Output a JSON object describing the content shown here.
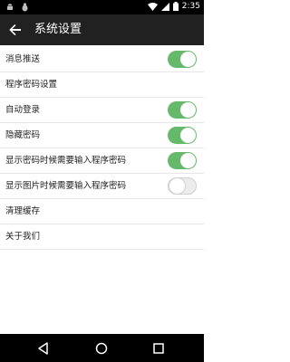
{
  "status_bar": {
    "time": "2:35",
    "icons": [
      "android-icon",
      "bug-icon",
      "wifi-icon",
      "signal-icon",
      "battery-icon"
    ]
  },
  "app_bar": {
    "title": "系统设置",
    "back_icon": "arrow-back-icon"
  },
  "settings": [
    {
      "label": "消息推送",
      "toggle": true
    },
    {
      "label": "程序密码设置"
    },
    {
      "label": "自动登录",
      "toggle": true
    },
    {
      "label": "隐藏密码",
      "toggle": true
    },
    {
      "label": "显示密码时候需要输入程序密码",
      "toggle": true
    },
    {
      "label": "显示图片时候需要输入程序密码",
      "toggle": false
    },
    {
      "label": "清理缓存"
    },
    {
      "label": "关于我们"
    }
  ],
  "nav_bar": {
    "buttons": [
      "back-icon",
      "home-icon",
      "recents-icon"
    ]
  },
  "colors": {
    "status_bar": "#000000",
    "app_bar": "#212121",
    "switch_on": "#64b96a",
    "switch_off": "#ececec",
    "divider": "#e6e6e6"
  }
}
